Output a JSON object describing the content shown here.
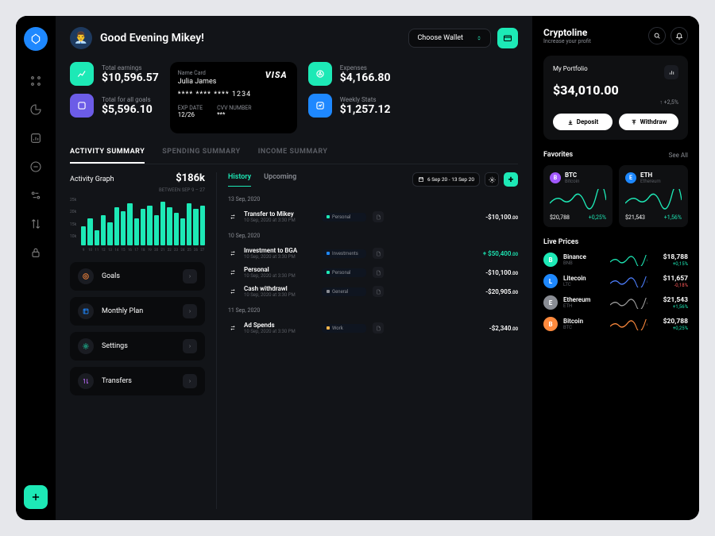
{
  "greeting": "Good Evening Mikey!",
  "avatar_emoji": "👨‍💼",
  "wallet_selector": "Choose Wallet",
  "stats": {
    "earnings": {
      "label": "Total earnings",
      "value": "$10,596.57",
      "color": "#1de9b6"
    },
    "goals": {
      "label": "Total for all goals",
      "value": "$5,596.10",
      "color": "#6c5ce7"
    },
    "expenses": {
      "label": "Expenses",
      "value": "$4,166.80",
      "color": "#1de9b6"
    },
    "weekly": {
      "label": "Weekly Stats",
      "value": "$1,257.12",
      "color": "#1e88ff"
    }
  },
  "card": {
    "name_label": "Name Card",
    "name": "Julia James",
    "number": "**** **** **** 1234",
    "exp_label": "EXP DATE",
    "exp": "12/26",
    "cvv_label": "CVV NUMBER",
    "cvv": "***",
    "brand": "VISA"
  },
  "tabs": [
    "ACTIVITY SUMMARY",
    "SPENDING SUMMARY",
    "INCOME SUMMARY"
  ],
  "activity_graph": {
    "title": "Activity Graph",
    "value": "$186k",
    "range": "BETWEEN SEP 9 – 27"
  },
  "chart_data": {
    "type": "bar",
    "title": "Activity Graph",
    "ylabel": "",
    "xlabel": "",
    "ylim": [
      0,
      25000
    ],
    "ytick_labels": [
      "25k",
      "20k",
      "15k",
      "10k"
    ],
    "categories": [
      "9",
      "10",
      "11",
      "12",
      "13",
      "14",
      "15",
      "16",
      "17",
      "18",
      "19",
      "20",
      "21",
      "22",
      "23",
      "24",
      "25",
      "26",
      "27"
    ],
    "values": [
      10000,
      14000,
      8000,
      16000,
      12000,
      20000,
      18000,
      22000,
      14000,
      19000,
      21000,
      16000,
      23000,
      20000,
      17000,
      14000,
      22000,
      19000,
      21000
    ]
  },
  "menu": [
    {
      "label": "Goals",
      "color": "#ff8a3d"
    },
    {
      "label": "Monthly Plan",
      "color": "#1e88ff"
    },
    {
      "label": "Settings",
      "color": "#1de9b6"
    },
    {
      "label": "Transfers",
      "color": "#c06cff"
    }
  ],
  "history": {
    "tabs": [
      "History",
      "Upcoming"
    ],
    "date_range": "6 Sep 20 - 13 Sep 20",
    "groups": [
      {
        "date": "13 Sep, 2020",
        "items": [
          {
            "title": "Transfer to Mikey",
            "sub": "10 Sep, 2020 at 3:30 PM",
            "tag": "Personal",
            "tag_color": "#1de9b6",
            "amt": "-$10,100",
            "cents": ".00",
            "cls": ""
          }
        ]
      },
      {
        "date": "10 Sep, 2020",
        "items": [
          {
            "title": "Investment to BGA",
            "sub": "10 Sep, 2020 at 3:30 PM",
            "tag": "Investments",
            "tag_color": "#1e88ff",
            "amt": "+ $50,400",
            "cents": ".00",
            "cls": "pos"
          },
          {
            "title": "Personal",
            "sub": "10 Sep, 2020 at 3:30 PM",
            "tag": "Personal",
            "tag_color": "#1de9b6",
            "amt": "-$10,100",
            "cents": ".00",
            "cls": ""
          },
          {
            "title": "Cash withdrawl",
            "sub": "10 Sep, 2020 at 3:30 PM",
            "tag": "General",
            "tag_color": "#8a8d94",
            "amt": "-$20,905",
            "cents": ".00",
            "cls": ""
          }
        ]
      },
      {
        "date": "11 Sep, 2020",
        "items": [
          {
            "title": "Ad Spends",
            "sub": "10 Sep, 2020 at 3:30 PM",
            "tag": "Work",
            "tag_color": "#ffb74d",
            "amt": "-$2,340",
            "cents": ".00",
            "cls": ""
          }
        ]
      }
    ]
  },
  "aside": {
    "brand": "Cryptoline",
    "tagline": "Increase your profit",
    "portfolio": {
      "label": "My Portfolio",
      "value": "$34,010.00",
      "delta": "↑ +2,5%",
      "deposit": "Deposit",
      "withdraw": "Withdraw"
    },
    "fav_label": "Favorites",
    "see_all": "See All",
    "favorites": [
      {
        "sym": "BTC",
        "name": "Bitcoin",
        "price": "$20,788",
        "delta": "+0,25%",
        "cls": "pos",
        "color": "#a259ff",
        "stroke": "#1de9b6"
      },
      {
        "sym": "ETH",
        "name": "Ethereum",
        "price": "$21,543",
        "delta": "+1,56%",
        "cls": "pos",
        "color": "#1e88ff",
        "stroke": "#1de9b6"
      }
    ],
    "live_label": "Live Prices",
    "live": [
      {
        "name": "Binance",
        "sym": "BNB",
        "price": "$18,788",
        "delta": "+0,15%",
        "cls": "pos",
        "color": "#1de9b6",
        "stroke": "#1de9b6"
      },
      {
        "name": "Litecoin",
        "sym": "LTC",
        "price": "$11,657",
        "delta": "-0,18%",
        "cls": "neg",
        "color": "#1e88ff",
        "stroke": "#4d7fff"
      },
      {
        "name": "Ethereum",
        "sym": "ETH",
        "price": "$21,543",
        "delta": "+1,56%",
        "cls": "pos",
        "color": "#8a8d94",
        "stroke": "#a0a0a0"
      },
      {
        "name": "Bitcoin",
        "sym": "BTC",
        "price": "$20,788",
        "delta": "+0,25%",
        "cls": "pos",
        "color": "#ff8a3d",
        "stroke": "#ff8a3d"
      }
    ]
  }
}
